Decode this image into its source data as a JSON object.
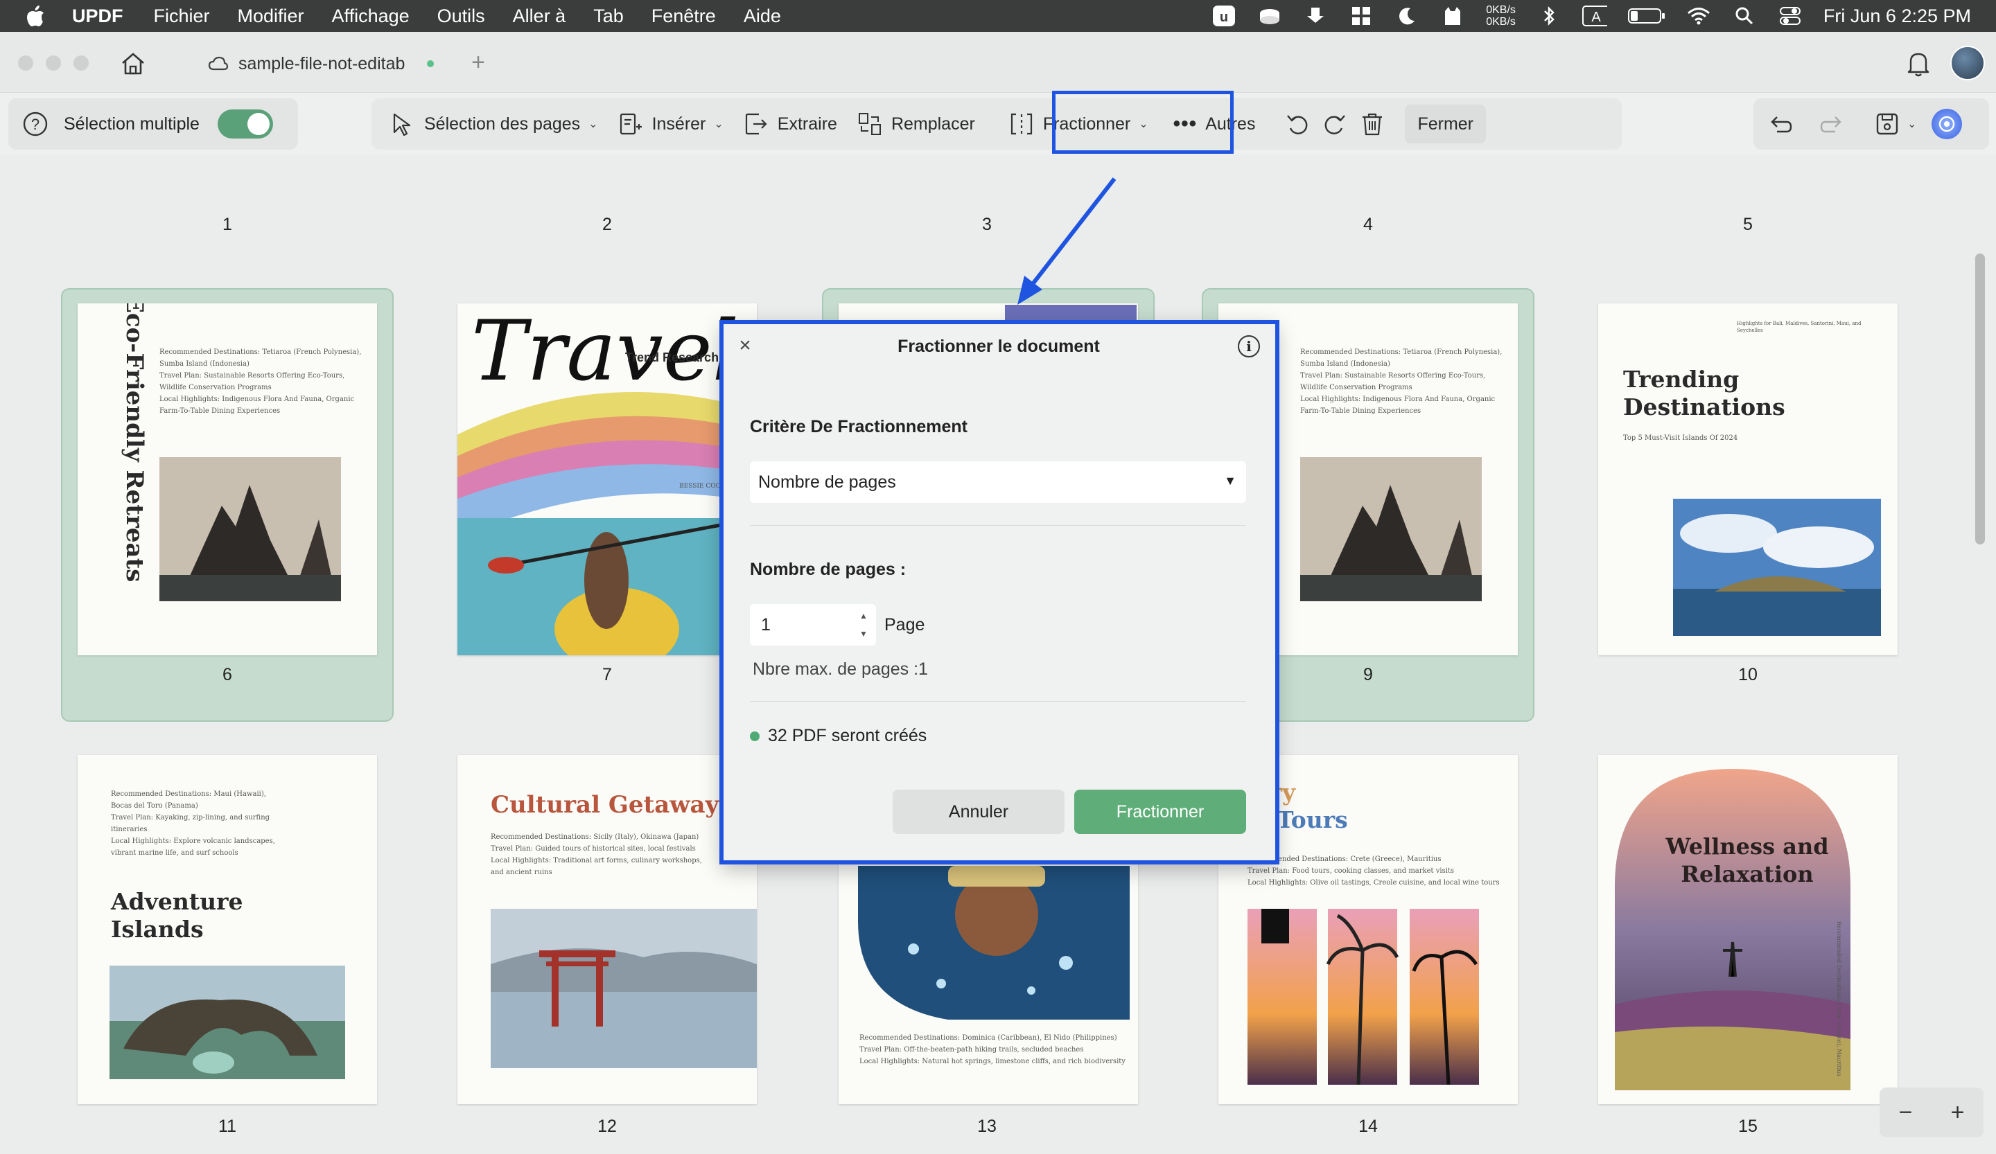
{
  "menubar": {
    "app": "UPDF",
    "items": [
      "Fichier",
      "Modifier",
      "Affichage",
      "Outils",
      "Aller à",
      "Tab",
      "Fenêtre",
      "Aide"
    ],
    "net_up": "0KB/s",
    "net_down": "0KB/s",
    "input_source": "A",
    "clock": "Fri Jun 6  2:25 PM"
  },
  "titlebar": {
    "doc_tab": "sample-file-not-editab"
  },
  "toolbar": {
    "multi_select": "Sélection multiple",
    "select_pages": "Sélection des pages",
    "insert": "Insérer",
    "extract": "Extraire",
    "replace": "Remplacer",
    "split": "Fractionner",
    "others": "Autres",
    "close": "Fermer"
  },
  "pages": {
    "row0_numbers": [
      "1",
      "2",
      "3",
      "4",
      "5"
    ],
    "row1_numbers": [
      "6",
      "7",
      "9",
      "10"
    ],
    "row2_numbers": [
      "11",
      "12",
      "13",
      "14",
      "15"
    ]
  },
  "thumbs": {
    "p6": {
      "title": "Eco-Friendly Retreats",
      "body": [
        "Recommended Destinations: Tetiaroa (French Polynesia),",
        "Sumba Island (Indonesia)",
        "Travel Plan: Sustainable Resorts Offering Eco-Tours,",
        "Wildlife Conservation Programs",
        "Local Highlights: Indigenous Flora And Fauna, Organic",
        "Farm-To-Table Dining Experiences"
      ]
    },
    "p7": {
      "script": "Travel",
      "label": "Trend Research",
      "author": "BESSIE COOP"
    },
    "p9": {
      "body": [
        "Recommended Destinations: Tetiaroa (French Polynesia),",
        "Sumba Island (Indonesia)",
        "Travel Plan: Sustainable Resorts Offering Eco-Tours,",
        "Wildlife Conservation Programs",
        "Local Highlights: Indigenous Flora And Fauna, Organic",
        "Farm-To-Table Dining Experiences"
      ]
    },
    "p10": {
      "title": "Trending Destinations",
      "subtitle": "Top 5 Must-Visit Islands Of 2024",
      "top": "Highlights for Bali, Maldives, Santorini, Maui, and Seychelles"
    },
    "p11": {
      "title": "Adventure Islands",
      "body": [
        "Recommended Destinations: Maui (Hawaii),",
        "Bocas del Toro (Panama)",
        "Travel Plan: Kayaking, zip-lining, and surfing",
        "itineraries",
        "Local Highlights: Explore volcanic landscapes,",
        "vibrant marine life, and surf schools"
      ]
    },
    "p12": {
      "title": "Cultural Getaways",
      "body": [
        "Recommended Destinations: Sicily (Italy), Okinawa (Japan)",
        "Travel Plan: Guided tours of historical sites, local festivals",
        "Local Highlights: Traditional art forms, culinary workshops,",
        "and ancient ruins"
      ]
    },
    "p13": {
      "body": [
        "Recommended Destinations: Dominica (Caribbean), El Nido (Philippines)",
        "Travel Plan: Off-the-beaten-path hiking trails, secluded beaches",
        "Local Highlights: Natural hot springs, limestone cliffs, and rich biodiversity"
      ]
    },
    "p14": {
      "title1": "linary",
      "title2": "and Tours",
      "body": [
        "Recommended Destinations: Crete (Greece), Mauritius",
        "Travel Plan: Food tours, cooking classes, and market visits",
        "Local Highlights: Olive oil tastings, Creole cuisine, and local wine tours"
      ]
    },
    "p15": {
      "title": "Wellness and Relaxation",
      "side": "Recommended Destinations: Crete (Greece), Mauritius"
    }
  },
  "dialog": {
    "title": "Fractionner le document",
    "criteria_label": "Critère De Fractionnement",
    "criteria_value": "Nombre de pages",
    "pages_label": "Nombre de pages :",
    "pages_value": "1",
    "pages_unit": "Page",
    "max_pages": "Nbre max. de pages :1",
    "result": "32 PDF seront créés",
    "cancel": "Annuler",
    "confirm": "Fractionner"
  },
  "colors": {
    "highlight": "#1e54e0",
    "accent_green": "#5fae79",
    "selected_page_bg": "#c6dccf"
  }
}
